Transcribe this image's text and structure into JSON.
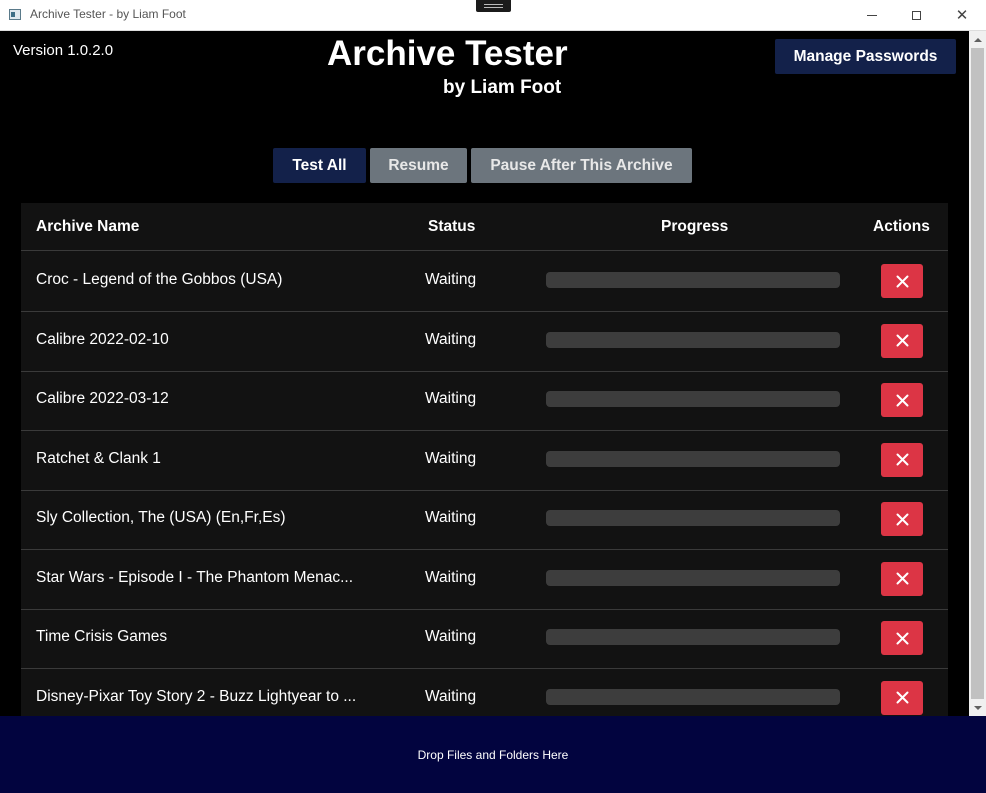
{
  "window": {
    "title": "Archive Tester - by Liam Foot"
  },
  "header": {
    "version": "Version 1.0.2.0",
    "title": "Archive Tester",
    "subtitle": "by Liam Foot",
    "manage_passwords_label": "Manage Passwords"
  },
  "toolbar": {
    "test_all_label": "Test All",
    "resume_label": "Resume",
    "pause_label": "Pause After This Archive"
  },
  "table": {
    "columns": {
      "name": "Archive Name",
      "status": "Status",
      "progress": "Progress",
      "actions": "Actions"
    },
    "rows": [
      {
        "name": "Croc - Legend of the Gobbos (USA)",
        "status": "Waiting",
        "progress": 0
      },
      {
        "name": "Calibre 2022-02-10",
        "status": "Waiting",
        "progress": 0
      },
      {
        "name": "Calibre 2022-03-12",
        "status": "Waiting",
        "progress": 0
      },
      {
        "name": "Ratchet & Clank 1",
        "status": "Waiting",
        "progress": 0
      },
      {
        "name": "Sly Collection, The (USA) (En,Fr,Es)",
        "status": "Waiting",
        "progress": 0
      },
      {
        "name": "Star Wars - Episode I - The Phantom Menac...",
        "status": "Waiting",
        "progress": 0
      },
      {
        "name": "Time Crisis Games",
        "status": "Waiting",
        "progress": 0
      },
      {
        "name": "Disney-Pixar Toy Story 2 - Buzz Lightyear to ...",
        "status": "Waiting",
        "progress": 0
      }
    ],
    "remove_icon": "close-x-icon"
  },
  "dropzone": {
    "label": "Drop Files and Folders Here"
  },
  "colors": {
    "primary": "#13214a",
    "secondary": "#6c757d",
    "danger": "#dc3545",
    "dropzone": "#02043f",
    "table_bg": "#121212"
  }
}
